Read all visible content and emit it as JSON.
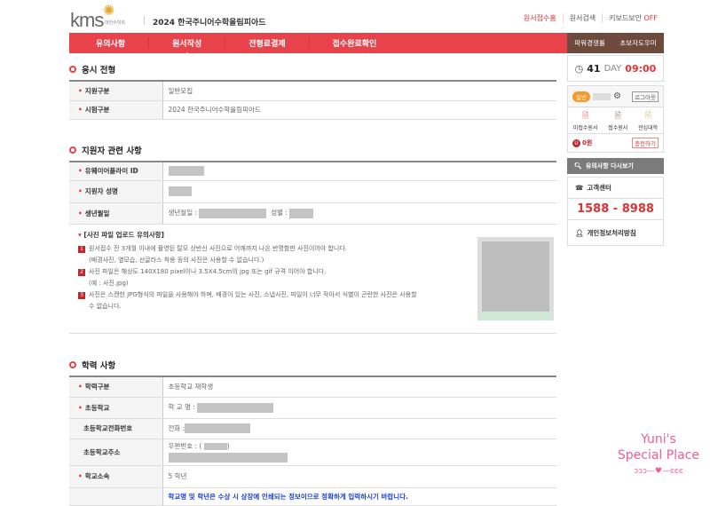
{
  "header": {
    "logo": "kms",
    "logo_sub": "대한수학회",
    "title": "2024 한국주니어수학올림피아드",
    "links": [
      "원서접수홈",
      "원서검색",
      "키보드보안"
    ],
    "keyboard_status": "OFF"
  },
  "nav": {
    "tabs": [
      "유의사항",
      "원서작성",
      "전형료결제",
      "접수완료확인"
    ],
    "side": [
      "파워경쟁률",
      "초보자도우미"
    ]
  },
  "sec1": {
    "title": "응시 전형",
    "rows": [
      {
        "label": "지원구분",
        "value": "일반모집"
      },
      {
        "label": "시험구분",
        "value": "2024 한국주니어수학올림피아드"
      }
    ]
  },
  "sec2": {
    "title": "지원자 관련 사항",
    "rows": [
      {
        "label": "유웨이어플라이 ID"
      },
      {
        "label": "지원자 성명"
      },
      {
        "label": "생년월일",
        "birth": "생년월일 :",
        "gender": "성별 :"
      }
    ],
    "notice": {
      "title": "[사진 파일 업로드 유의사항]",
      "items": [
        {
          "n": "1",
          "lines": [
            "원서접수 전 3개월 이내에 촬영된 탈모 상반신 사진으로 어깨까지 나온 반명함판 사진이어야 합니다.",
            "(배경사진, 옆모습, 선글라스 착용 등의 사진은 사용할 수 없습니다.)"
          ]
        },
        {
          "n": "2",
          "lines": [
            "사진 파일은 해상도 140X180 pixel이나 3.5X4.5cm의 jpg 또는 gif 규격 이어야 합니다.",
            "(예 : 사진.jpg)"
          ]
        },
        {
          "n": "3",
          "lines": [
            "사진은 스캔한 JPG형식의 파일을 사용해야 하며, 배경이 있는 사진, 스냅사진, 파일이 너무 작아서 식별이 곤란한 사진은 사용할",
            "수 없습니다."
          ]
        }
      ]
    }
  },
  "sec3": {
    "title": "학력 사항",
    "rows": [
      {
        "label": "학력구분",
        "value": "초등학교 재학생"
      },
      {
        "label": "초등학교",
        "value": "학 교 명 :"
      },
      {
        "label": "초등학교전화번호",
        "value": "전화 :"
      },
      {
        "label": "초등학교주소",
        "value": "우편번호 : ("
      },
      {
        "label": "학교소속",
        "value": "5 학년"
      },
      {
        "label": "",
        "value": "학교명 및 학년은 수상 시 상장에 인쇄되는 정보이므로 정확하게 입력하시기 바랍니다."
      }
    ]
  },
  "sidebar": {
    "days": "41",
    "day_label": "DAY",
    "time": "09:00",
    "badge": "일반",
    "logout": "로그아웃",
    "icons": [
      "미접수원서",
      "접수원서",
      "관심대학"
    ],
    "points": "0원",
    "charge": "충전하기",
    "notice_btn": "유의사항 다시보기",
    "cs_title": "고객센터",
    "phone": "1588 - 8988",
    "privacy": "개인정보처리방침"
  },
  "watermark": {
    "line1": "Yuni's",
    "line2": "Special Place"
  }
}
